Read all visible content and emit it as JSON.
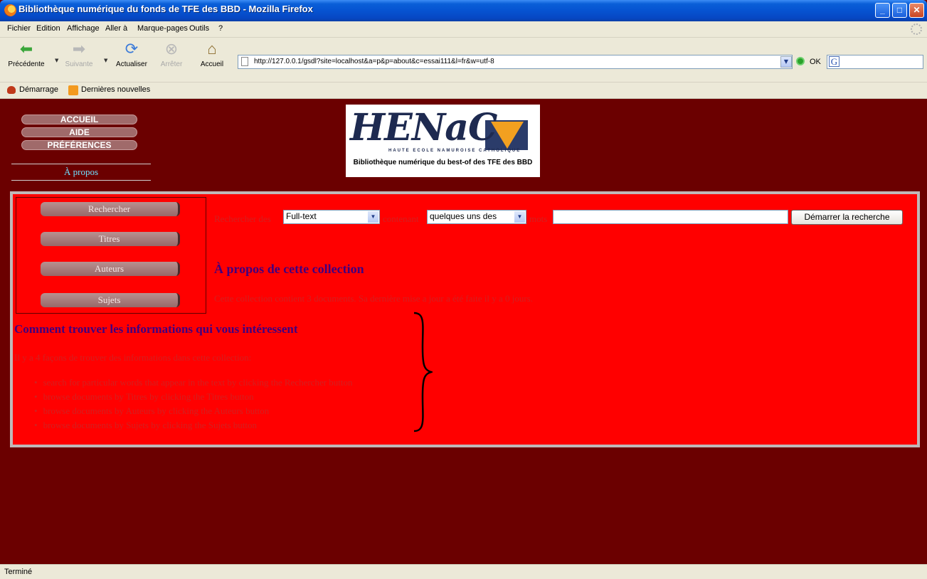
{
  "window": {
    "title": "Bibliothèque numérique du fonds de TFE des BBD - Mozilla Firefox"
  },
  "menu": [
    "Fichier",
    "Edition",
    "Affichage",
    "Aller à",
    "Marque-pages",
    "Outils",
    "?"
  ],
  "toolbar": {
    "back": "Précédente",
    "forward": "Suivante",
    "reload": "Actualiser",
    "stop": "Arrêter",
    "home": "Accueil",
    "url": "http://127.0.0.1/gsdl?site=localhost&a=p&p=about&c=essai111&l=fr&w=utf-8",
    "go": "OK",
    "search_engine_icon": "G"
  },
  "bookmarks": [
    "Démarrage",
    "Dernières nouvelles"
  ],
  "page": {
    "nav": [
      "ACCUEIL",
      "AIDE",
      "PRÉFÉRENCES"
    ],
    "current_page": "À propos",
    "logo": {
      "title": "HENaC",
      "subtitle": "HAUTE ECOLE NAMUROISE CATHOLIQUE",
      "caption": "Bibliothèque numérique du best-of des TFE des BBD"
    },
    "side_buttons": [
      "Rechercher",
      "Titres",
      "Auteurs",
      "Sujets"
    ],
    "search": {
      "label_search": "Rechercher des",
      "field_value": "Full-text",
      "label_containing": "contenant",
      "mode_value": "quelques uns des",
      "label_words": "mots",
      "query_value": "",
      "submit": "Démarrer la recherche"
    },
    "about_title": "À propos de cette collection",
    "about_text": "Cette collection contient 3 documents. Sa dernière mise a jour a été faite il y a 0 jours.",
    "howto_title": "Comment trouver les informations qui vous intéressent",
    "howto_intro": "Il y a 4 façons de trouver des informations dans cette collection:",
    "howto_items": [
      "search for particular words that appear in the text by clicking the Rechercher button",
      "browse documents by Titres by clicking the Titres button",
      "browse documents by Auteurs by clicking the Auteurs button",
      "browse documents by Sujets by clicking the Sujets button"
    ]
  },
  "status": "Terminé",
  "colors": {
    "page_bg": "#6b0000",
    "panel_bg": "#ff0000",
    "heading": "#400080",
    "body_text": "#d32020",
    "link": "#6fe0ff"
  }
}
